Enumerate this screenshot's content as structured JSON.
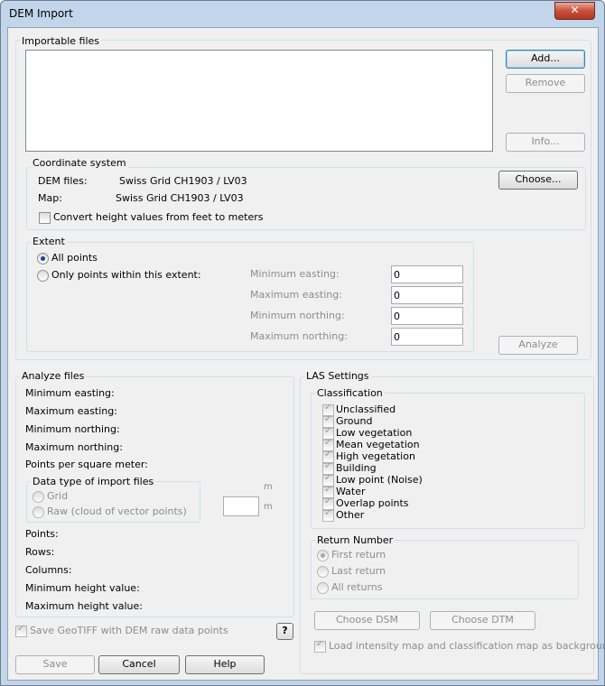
{
  "window": {
    "title": "DEM Import",
    "close_glyph": "✕"
  },
  "importable": {
    "group_label": "Importable files",
    "add": "Add...",
    "remove": "Remove",
    "info": "Info..."
  },
  "coordinate": {
    "group_label": "Coordinate system",
    "dem_label": "DEM files:",
    "dem_value": "Swiss Grid  CH1903 / LV03",
    "map_label": "Map:",
    "map_value": "Swiss Grid  CH1903 / LV03",
    "choose": "Choose...",
    "convert_label": "Convert height values from feet to meters",
    "convert_checked": false
  },
  "extent": {
    "group_label": "Extent",
    "all_points": "All points",
    "within": "Only points within this extent:",
    "selected": "all_points",
    "min_easting_label": "Minimum easting:",
    "min_easting": "0",
    "max_easting_label": "Maximum easting:",
    "max_easting": "0",
    "min_northing_label": "Minimum northing:",
    "min_northing": "0",
    "max_northing_label": "Maximum northing:",
    "max_northing": "0",
    "analyze": "Analyze"
  },
  "analyze_files": {
    "group_label": "Analyze files",
    "min_easting": "Minimum easting:",
    "max_easting": "Maximum easting:",
    "min_northing": "Minimum northing:",
    "max_northing": "Maximum northing:",
    "points_per_sqm": "Points per square meter:",
    "datatype_label": "Data type of import files",
    "grid": "Grid",
    "raw": "Raw (cloud of vector points)",
    "unit1": "m",
    "unit2": "m",
    "points": "Points:",
    "rows": "Rows:",
    "columns": "Columns:",
    "min_height": "Minimum height value:",
    "max_height": "Maximum height value:"
  },
  "las": {
    "group_label": "LAS Settings",
    "classification_label": "Classification",
    "classes": [
      "Unclassified",
      "Ground",
      "Low vegetation",
      "Mean vegetation",
      "High vegetation",
      "Building",
      "Low point (Noise)",
      "Water",
      "Overlap points",
      "Other"
    ],
    "return_label": "Return Number",
    "returns": [
      "First return",
      "Last return",
      "All returns"
    ],
    "return_selected": "First return",
    "choose_dsm": "Choose DSM",
    "choose_dtm": "Choose DTM",
    "load_intensity": "Load intensity map and classification map as background"
  },
  "footer": {
    "save_geotiff": "Save GeoTIFF with DEM raw data points",
    "help_glyph": "?",
    "save": "Save",
    "cancel": "Cancel",
    "help": "Help"
  }
}
